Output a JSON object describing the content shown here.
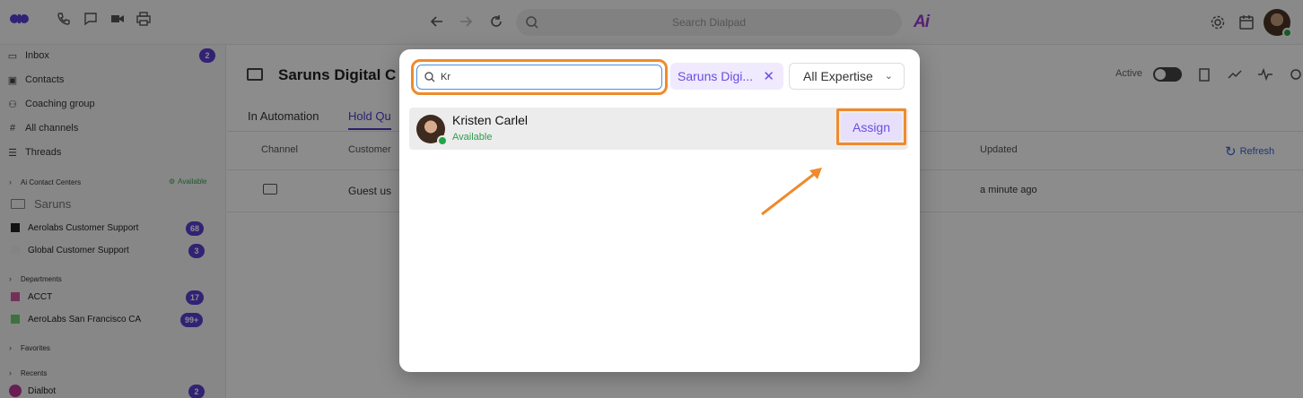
{
  "topbar": {
    "search_placeholder": "Search Dialpad",
    "ai_logo": "Ai"
  },
  "sidebar": {
    "items": [
      {
        "label": "Inbox",
        "badge": "2",
        "icon": "inbox-icon"
      },
      {
        "label": "Contacts",
        "icon": "contacts-icon"
      },
      {
        "label": "Coaching group",
        "icon": "users-icon"
      },
      {
        "label": "All channels",
        "icon": "hash-icon"
      },
      {
        "label": "Threads",
        "icon": "threads-icon"
      }
    ],
    "ai_contact_centers": {
      "label": "Ai Contact Centers",
      "status": "Available"
    },
    "current_group": "Saruns",
    "contact_centers": [
      {
        "label": "Aerolabs Customer Support",
        "badge": "68",
        "color": "#222222"
      },
      {
        "label": "Global Customer Support",
        "badge": "3",
        "color": "#f0f0f0"
      }
    ],
    "departments_label": "Departments",
    "departments": [
      {
        "label": "ACCT",
        "badge": "17",
        "color": "#d45aa0"
      },
      {
        "label": "AeroLabs San Francisco CA",
        "badge": "99+",
        "color": "#6fcf6f"
      }
    ],
    "favorites_label": "Favorites",
    "recents_label": "Recents",
    "recents": [
      {
        "label": "Dialbot",
        "badge": "2"
      }
    ]
  },
  "main": {
    "title": "Saruns Digital C",
    "active_label": "Active",
    "tabs": [
      "In Automation",
      "Hold Qu"
    ],
    "columns": {
      "channel": "Channel",
      "customer": "Customer",
      "updated": "Updated"
    },
    "refresh_label": "Refresh",
    "row": {
      "customer": "Guest us",
      "updated": "a minute ago"
    }
  },
  "modal": {
    "search_value": "Kr",
    "filter_chip": "Saruns Digi...",
    "expertise_dropdown": "All Expertise",
    "agent": {
      "name": "Kristen Carlel",
      "status": "Available"
    },
    "assign_label": "Assign"
  },
  "colors": {
    "highlight": "#f08a2c",
    "accent": "#6a4de0",
    "available": "#2e9d4c"
  }
}
